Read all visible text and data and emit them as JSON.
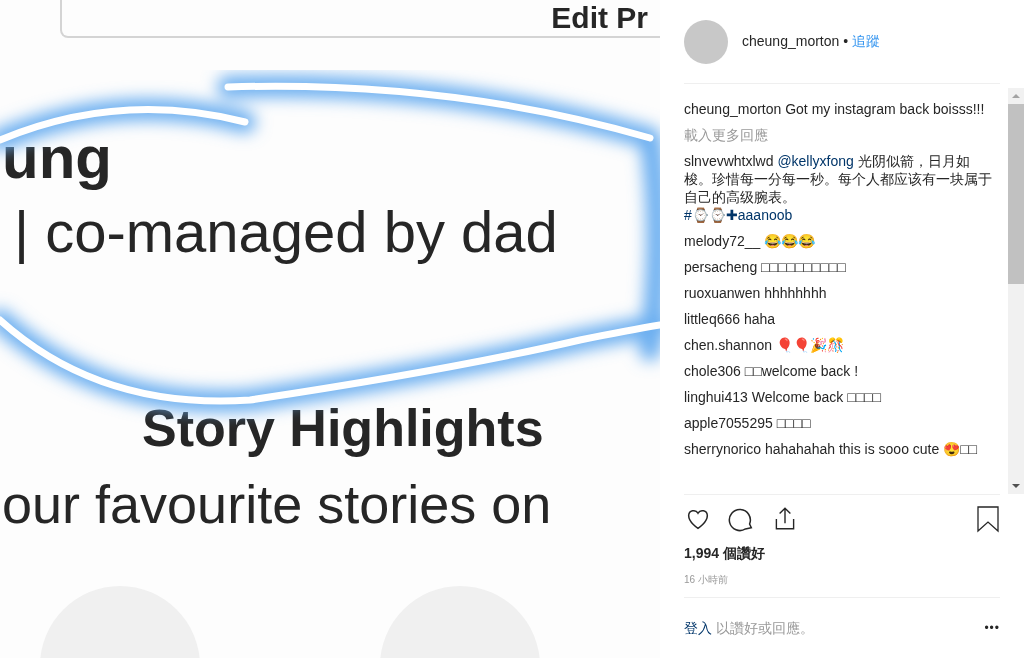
{
  "photo": {
    "button_label": "Edit Pr",
    "name": "ung",
    "bio": "| co-managed by dad",
    "heading": "Story Highlights",
    "subtext": "our favourite stories on"
  },
  "post": {
    "author": "cheung_morton",
    "separator": "•",
    "follow": "追蹤",
    "caption": {
      "user": "cheung_morton",
      "text": "Got my instagram back boisss!!!"
    },
    "load_more": "載入更多回應",
    "comments": [
      {
        "user": "slnvevwhtxlwd",
        "parts": [
          {
            "kind": "mention",
            "text": "@kellyxfong"
          },
          {
            "kind": "text",
            "text": "光阴似箭，日月如梭。珍惜每一分每一秒。每个人都应该有一块属于自己的高级腕表。"
          },
          {
            "kind": "tag",
            "text": "#⌚⌚✚aaanoob"
          }
        ]
      },
      {
        "user": "melody72__",
        "parts": [
          {
            "kind": "text",
            "text": "😂😂😂"
          }
        ]
      },
      {
        "user": "persacheng",
        "parts": [
          {
            "kind": "text",
            "text": "□□□□□□□□□□"
          }
        ]
      },
      {
        "user": "ruoxuanwen",
        "parts": [
          {
            "kind": "text",
            "text": "hhhhhhhh"
          }
        ]
      },
      {
        "user": "littleq666",
        "parts": [
          {
            "kind": "text",
            "text": "haha"
          }
        ]
      },
      {
        "user": "chen.shannon",
        "parts": [
          {
            "kind": "text",
            "text": "🎈🎈🎉🎊"
          }
        ]
      },
      {
        "user": "chole306",
        "parts": [
          {
            "kind": "text",
            "text": "□□welcome back !"
          }
        ]
      },
      {
        "user": "linghui413",
        "parts": [
          {
            "kind": "text",
            "text": "Welcome back □□□□"
          }
        ]
      },
      {
        "user": "apple7055295",
        "parts": [
          {
            "kind": "text",
            "text": "□□□□"
          }
        ]
      },
      {
        "user": "sherrynorico",
        "parts": [
          {
            "kind": "text",
            "text": "hahahahah this is sooo cute 😍□□"
          }
        ]
      }
    ],
    "likes": "1,994 個讚好",
    "time": "16 小時前",
    "login_link": "登入",
    "login_text": "以讚好或回應。",
    "more": "•••"
  }
}
